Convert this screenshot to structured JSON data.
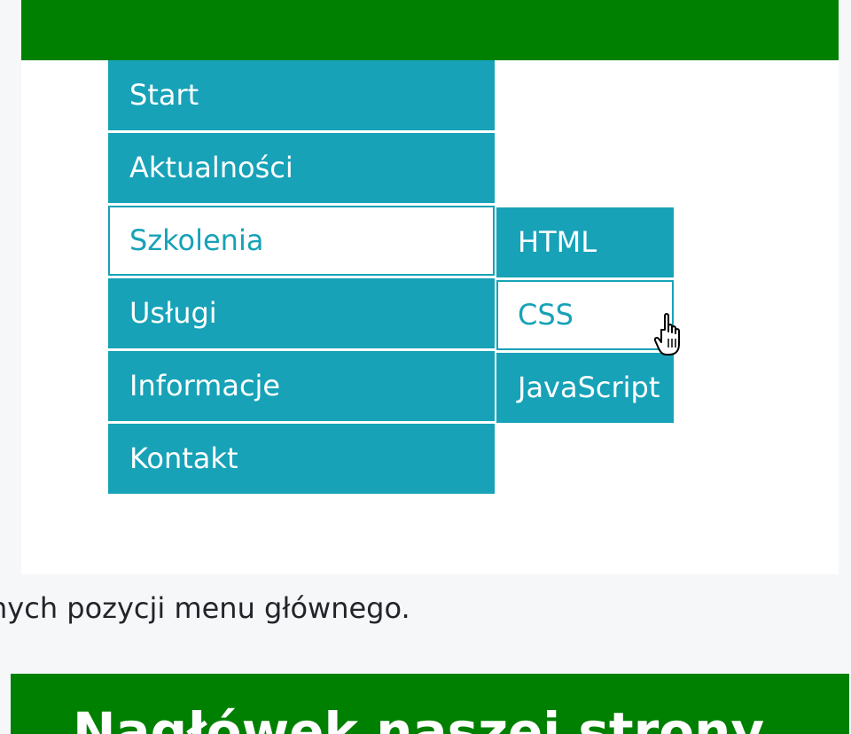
{
  "main_menu": {
    "items": [
      {
        "label": "Start"
      },
      {
        "label": "Aktualności"
      },
      {
        "label": "Szkolenia"
      },
      {
        "label": "Usługi"
      },
      {
        "label": "Informacje"
      },
      {
        "label": "Kontakt"
      }
    ],
    "active_item": "Szkolenia"
  },
  "sub_menu": {
    "items": [
      {
        "label": "HTML"
      },
      {
        "label": "CSS"
      },
      {
        "label": "JavaScript"
      }
    ],
    "hovered_item": "CSS"
  },
  "caption": {
    "text": "nych pozycji menu głównego."
  },
  "page_header": {
    "title": "Nagłówek naszej strony"
  },
  "colors": {
    "menu_bg": "#17a2b8",
    "header_green": "#008000",
    "page_bg": "#f6f7f9"
  },
  "icons": {
    "cursor": "hand-pointer-icon"
  }
}
